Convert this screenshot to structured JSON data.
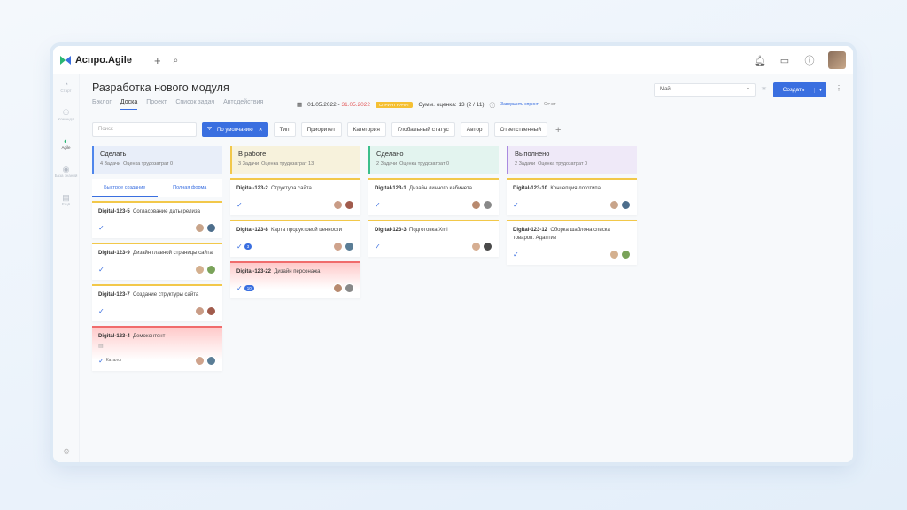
{
  "app": {
    "name": "Аспро.Agile"
  },
  "sidebar": {
    "items": [
      {
        "label": "Старт",
        "icon": "rocket-icon"
      },
      {
        "label": "Команда",
        "icon": "team-icon"
      },
      {
        "label": "Agile",
        "icon": "agile-icon",
        "active": true
      },
      {
        "label": "База знаний",
        "icon": "knowledge-icon"
      },
      {
        "label": "Ещё",
        "icon": "more-icon"
      }
    ]
  },
  "page": {
    "title": "Разработка нового модуля"
  },
  "tabs": [
    "Бэклог",
    "Доска",
    "Проект",
    "Список задач",
    "Автодействия"
  ],
  "sprint": {
    "date_start": "01.05.2022",
    "date_sep": " - ",
    "date_end": "31.05.2022",
    "status": "СПРИНТ НАЧАТ",
    "sum_label": "Сумм. оценка:",
    "sum_value": "13",
    "progress": "(2 / 11)",
    "finish_link": "Завершить спринт",
    "report_link": "Отчет"
  },
  "toolbar": {
    "sprint_select": "Май",
    "create_label": "Создать"
  },
  "filters": {
    "search_placeholder": "Поиск",
    "default_chip": "По умолчанию",
    "chips": [
      "Тип",
      "Приоритет",
      "Категория",
      "Глобальный статус",
      "Автор",
      "Ответственный"
    ]
  },
  "columns": [
    {
      "title": "Сделать",
      "tasks": "4 Задачи",
      "effort": "Оценка трудозатрат 0",
      "color": "#4f86ec",
      "bg": "#e8eef9",
      "quick": [
        "Быстрое создание",
        "Полная форма"
      ],
      "cards": [
        {
          "code": "Digital-123-5",
          "title": "Согласование даты релиза",
          "red": false
        },
        {
          "code": "Digital-123-9",
          "title": "Дизайн главной страницы сайта",
          "red": false
        },
        {
          "code": "Digital-123-7",
          "title": "Создание структуры сайта",
          "red": false
        },
        {
          "code": "Digital-123-4",
          "title": "Демоконтент",
          "red": true,
          "tag": "Каталог"
        }
      ]
    },
    {
      "title": "В работе",
      "tasks": "3 Задачи",
      "effort": "Оценка трудозатрат 13",
      "color": "#f2c84a",
      "bg": "#f7f2dc",
      "cards": [
        {
          "code": "Digital-123-2",
          "title": "Структура сайта",
          "red": false
        },
        {
          "code": "Digital-123-8",
          "title": "Карта продуктовой ценности",
          "red": false,
          "count": "3"
        },
        {
          "code": "Digital-123-22",
          "title": "Дизайн персонажа",
          "red": true,
          "count": "10"
        }
      ]
    },
    {
      "title": "Сделано",
      "tasks": "2 Задачи",
      "effort": "Оценка трудозатрат 0",
      "color": "#3cbf8c",
      "bg": "#e3f4ef",
      "cards": [
        {
          "code": "Digital-123-1",
          "title": "Дизайн личного кабинета",
          "red": false
        },
        {
          "code": "Digital-123-3",
          "title": "Подготовка Xml",
          "red": false
        }
      ]
    },
    {
      "title": "Выполнено",
      "tasks": "2 Задачи",
      "effort": "Оценка трудозатрат 0",
      "color": "#a98be0",
      "bg": "#efe9f8",
      "cards": [
        {
          "code": "Digital-123-10",
          "title": "Концепция логотипа",
          "red": false
        },
        {
          "code": "Digital-123-12",
          "title": "Сборка шаблона списка товаров. Адаптив",
          "red": false
        }
      ]
    }
  ]
}
